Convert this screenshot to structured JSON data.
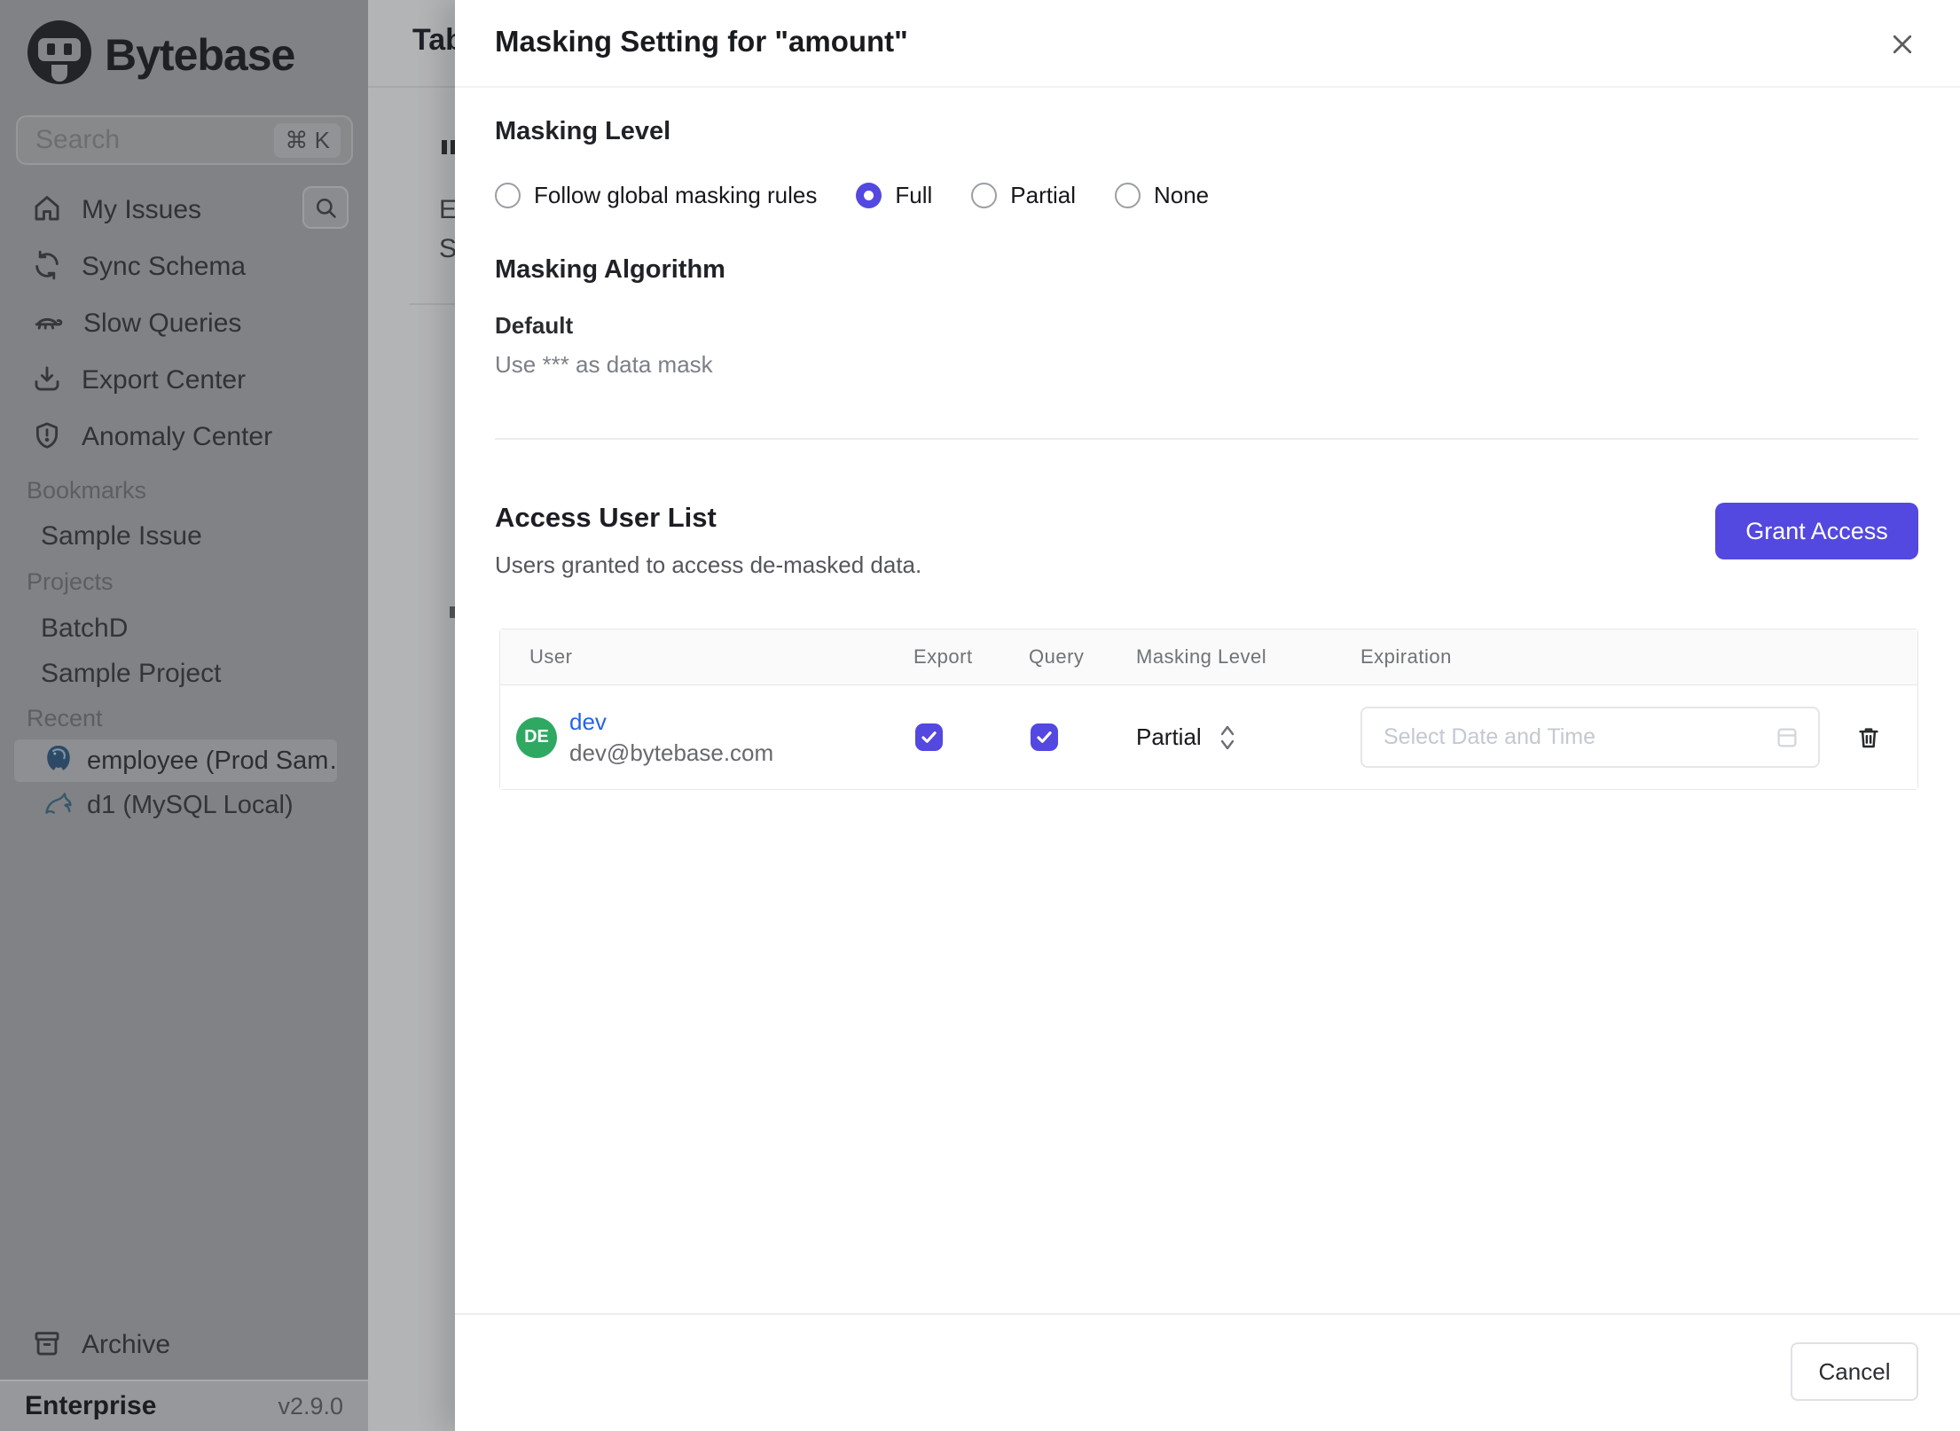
{
  "colors": {
    "accent": "#5348e0",
    "avatar_green": "#2fa962",
    "link_blue": "#2563eb"
  },
  "sidebar": {
    "logo_text": "Bytebase",
    "search": {
      "placeholder": "Search",
      "shortcut": "⌘ K"
    },
    "nav": [
      {
        "label": "My Issues"
      },
      {
        "label": "Sync Schema"
      },
      {
        "label": "Slow Queries"
      },
      {
        "label": "Export Center"
      },
      {
        "label": "Anomaly Center"
      }
    ],
    "sections": [
      {
        "title": "Bookmarks",
        "items": [
          {
            "label": "Sample Issue"
          }
        ]
      },
      {
        "title": "Projects",
        "items": [
          {
            "label": "BatchD"
          },
          {
            "label": "Sample Project"
          }
        ]
      },
      {
        "title": "Recent",
        "items": [
          {
            "label": "employee (Prod Sam…",
            "icon": "postgresql-icon",
            "selected": true
          },
          {
            "label": "d1 (MySQL Local)",
            "icon": "mysql-icon",
            "selected": false
          }
        ]
      }
    ],
    "archive_label": "Archive",
    "footer": {
      "plan": "Enterprise",
      "version": "v2.9.0"
    }
  },
  "background_page": {
    "title_fragment": "Tab",
    "fragment_e": "E",
    "fragment_s": "S"
  },
  "modal": {
    "title": "Masking Setting for \"amount\"",
    "masking_level": {
      "heading": "Masking Level",
      "options": [
        {
          "label": "Follow global masking rules",
          "selected": false
        },
        {
          "label": "Full",
          "selected": true
        },
        {
          "label": "Partial",
          "selected": false
        },
        {
          "label": "None",
          "selected": false
        }
      ]
    },
    "masking_algorithm": {
      "heading": "Masking Algorithm",
      "name": "Default",
      "description": "Use *** as data mask"
    },
    "access": {
      "heading": "Access User List",
      "subheading": "Users granted to access de-masked data.",
      "grant_button": "Grant Access",
      "table": {
        "columns": [
          "User",
          "Export",
          "Query",
          "Masking Level",
          "Expiration"
        ],
        "rows": [
          {
            "name": "dev",
            "email": "dev@bytebase.com",
            "avatar_initials": "DE",
            "export_checked": true,
            "query_checked": true,
            "masking_level": "Partial",
            "expiration_placeholder": "Select Date and Time"
          }
        ]
      }
    },
    "cancel_label": "Cancel"
  }
}
